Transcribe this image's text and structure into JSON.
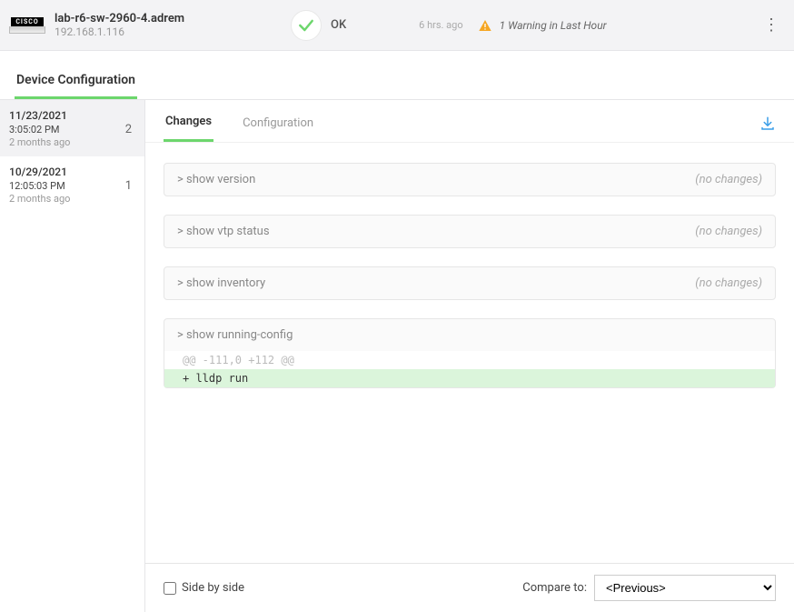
{
  "header": {
    "vendor": "CISCO",
    "device_name": "lab-r6-sw-2960-4.adrem",
    "device_ip": "192.168.1.116",
    "status_text": "OK",
    "status_time": "6 hrs. ago",
    "warning_text": "1 Warning in Last Hour"
  },
  "section_title": "Device Configuration",
  "revisions": [
    {
      "date": "11/23/2021",
      "time": "3:05:02 PM",
      "ago": "2 months ago",
      "change_count": "2",
      "active": true
    },
    {
      "date": "10/29/2021",
      "time": "12:05:03 PM",
      "ago": "2 months ago",
      "change_count": "1",
      "active": false
    }
  ],
  "tabs": {
    "changes": "Changes",
    "configuration": "Configuration"
  },
  "commands": [
    {
      "prompt": "> show version",
      "status": "(no changes)",
      "diff": null
    },
    {
      "prompt": "> show vtp status",
      "status": "(no changes)",
      "diff": null
    },
    {
      "prompt": "> show inventory",
      "status": "(no changes)",
      "diff": null
    },
    {
      "prompt": "> show running-config",
      "status": "",
      "diff": {
        "hunk_header": "@@ -111,0 +112 @@",
        "added_line": "+ lldp run"
      }
    }
  ],
  "footer": {
    "side_by_side_label": "Side by side",
    "compare_label": "Compare to:",
    "compare_value": "<Previous>"
  }
}
